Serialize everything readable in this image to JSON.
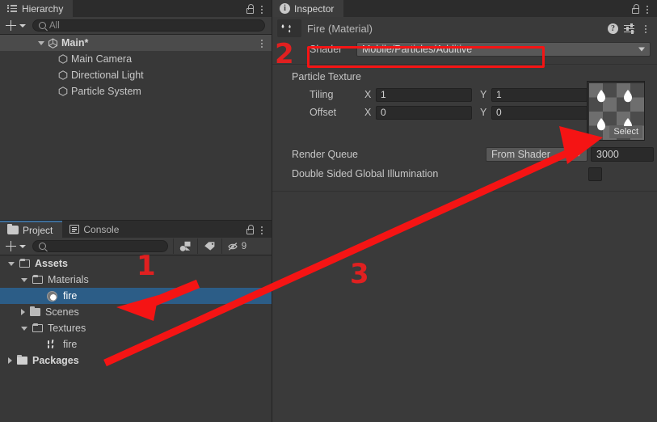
{
  "hierarchy": {
    "tab_label": "Hierarchy",
    "tab_icon": "hierarchy-list-icon",
    "lock_icon": "lock-icon",
    "menu_icon": "kebab-menu-icon",
    "toolbar": {
      "add_label": "+",
      "add_icon": "plus-icon",
      "dropdown_icon": "chevron-down-icon",
      "search_placeholder": "All",
      "search_value": "",
      "search_icon": "search-icon"
    },
    "items": [
      {
        "label": "Main*",
        "indent": 1,
        "icon": "unity-scene-icon",
        "expanded": true,
        "selected": false,
        "bold": true,
        "has_menu": true
      },
      {
        "label": "Main Camera",
        "indent": 2,
        "icon": "gameobject-icon",
        "expanded": null,
        "selected": false,
        "bold": false,
        "has_menu": false
      },
      {
        "label": "Directional Light",
        "indent": 2,
        "icon": "gameobject-icon",
        "expanded": null,
        "selected": false,
        "bold": false,
        "has_menu": false
      },
      {
        "label": "Particle System",
        "indent": 2,
        "icon": "gameobject-icon",
        "expanded": null,
        "selected": false,
        "bold": false,
        "has_menu": false
      }
    ]
  },
  "project": {
    "tabs": [
      {
        "label": "Project",
        "icon": "folder-icon",
        "active": true
      },
      {
        "label": "Console",
        "icon": "console-icon",
        "active": false
      }
    ],
    "lock_icon": "lock-icon",
    "menu_icon": "kebab-menu-icon",
    "toolbar": {
      "add_label": "+",
      "add_icon": "plus-icon",
      "dropdown_icon": "chevron-down-icon",
      "search_placeholder": "",
      "search_value": "",
      "search_icon": "search-icon",
      "filter_by_type_icon": "asset-type-filter-icon",
      "filter_by_label_icon": "label-tag-icon",
      "hidden_packages_icon": "eye-crossed-icon",
      "hidden_packages_count": "9"
    },
    "items": [
      {
        "label": "Assets",
        "indent": 0,
        "icon": "folder-open-icon",
        "expanded": true,
        "selected": false,
        "bold": true
      },
      {
        "label": "Materials",
        "indent": 1,
        "icon": "folder-open-icon",
        "expanded": true,
        "selected": false,
        "bold": false
      },
      {
        "label": "fire",
        "indent": 2,
        "icon": "material-icon",
        "expanded": null,
        "selected": true,
        "bold": false
      },
      {
        "label": "Scenes",
        "indent": 1,
        "icon": "folder-icon",
        "expanded": false,
        "selected": false,
        "bold": false
      },
      {
        "label": "Textures",
        "indent": 1,
        "icon": "folder-open-icon",
        "expanded": true,
        "selected": false,
        "bold": false
      },
      {
        "label": "fire",
        "indent": 2,
        "icon": "texture-icon",
        "expanded": null,
        "selected": false,
        "bold": false
      },
      {
        "label": "Packages",
        "indent": 0,
        "icon": "folder-icon",
        "expanded": false,
        "selected": false,
        "bold": true
      }
    ]
  },
  "inspector": {
    "tab_label": "Inspector",
    "tab_icon": "info-icon",
    "lock_icon": "lock-icon",
    "menu_icon": "kebab-menu-icon",
    "asset_title": "Fire (Material)",
    "preview_icon": "material-preview-thumbnail",
    "help_icon": "help-icon",
    "preset_icon": "preset-settings-icon",
    "more_icon": "kebab-menu-icon",
    "shader": {
      "label": "Shader",
      "value": "Mobile/Particles/Additive",
      "dropdown_icon": "chevron-down-icon"
    },
    "particle_texture": {
      "section_label": "Particle Texture",
      "tiling_label": "Tiling",
      "offset_label": "Offset",
      "x_label": "X",
      "y_label": "Y",
      "tiling_x": "1",
      "tiling_y": "1",
      "offset_x": "0",
      "offset_y": "0",
      "select_button": "Select",
      "thumbnail_icon": "fire-texture-thumbnail"
    },
    "render_queue": {
      "label": "Render Queue",
      "mode": "From Shader",
      "dropdown_icon": "chevron-down-icon",
      "value": "3000"
    },
    "double_sided_gi": {
      "label": "Double Sided Global Illumination",
      "checked": false
    }
  },
  "annotations": {
    "accent_color": "#f51414",
    "outline_color": "#ffffff",
    "markers": [
      {
        "id": "1",
        "text": "1"
      },
      {
        "id": "2",
        "text": "2"
      },
      {
        "id": "3",
        "text": "3"
      }
    ],
    "highlight_rect_target": "shader-field",
    "arrow_1_target": "project-item-fire-material",
    "arrow_3_target": "particle-texture-slot"
  },
  "colors": {
    "panel_bg": "#383838",
    "inspector_bg": "#3a3a3a",
    "tabbar_bg": "#2c2c2c",
    "selection_blue": "#2c5d87",
    "scene_row": "#4b4b4b",
    "field_dark": "#2a2a2a",
    "field_light": "#585858"
  }
}
